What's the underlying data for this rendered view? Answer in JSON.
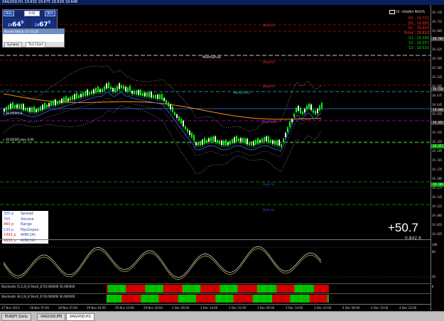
{
  "window": {
    "title": "XAGUSD,H1  19.632 19.675 19.629 19.648"
  },
  "trade_panel": {
    "sell_label": "SELL",
    "lot_value": "0.02",
    "buy_label": "BUY",
    "bid": {
      "prefix": "19",
      "big": "64",
      "sup": "5"
    },
    "ask": {
      "prefix": "19",
      "big": "67",
      "sup": "5"
    }
  },
  "market_watch": {
    "title": "Market Watch: 07:55:20",
    "tabs": [
      "Symbols",
      "Tick Chart"
    ]
  },
  "logo_text": "FX - HOURLY PIVOTS",
  "levels": {
    "daily_r3": "Daily R3",
    "daily_r2": "Daily R2",
    "daily_r1": "Daily R1",
    "monthly_pivot": "MonthlyPivot",
    "weekly_pivot": "WeeklyPivot",
    "daily_pivot": "Daily Pivot",
    "level_a": "» 19.25[00] 8",
    "level_b": "» 19.02[00]_box_0.00",
    "daily_s1": "Daily S1",
    "daily_s2": "Daily S2"
  },
  "pivots": [
    {
      "label": "R3 : 19.721",
      "color": "#ff2a2a"
    },
    {
      "label": "R2 : 19.683",
      "color": "#ff2a2a"
    },
    {
      "label": "R1 : 19.650",
      "color": "#ff2a2a"
    },
    {
      "label": "Pivot : 19.620",
      "color": "#ff3333"
    },
    {
      "label": "S1 : 19.595",
      "color": "#00e000"
    },
    {
      "label": "S2 : 19.557",
      "color": "#00e000"
    },
    {
      "label": "S3 : 19.520",
      "color": "#00e000"
    }
  ],
  "y_axis": {
    "ticks": [
      "19.745",
      "19.715",
      "19.685",
      "19.655",
      "19.625",
      "19.595",
      "19.565",
      "19.535",
      "19.505",
      "19.475",
      "19.445",
      "19.415",
      "19.385",
      "19.355",
      "19.325",
      "19.295",
      "19.265",
      "19.235",
      "19.205",
      "19.175",
      "19.145",
      "19.115",
      "19.085",
      "19.055",
      "19.025"
    ],
    "tags": [
      {
        "text": "19.745",
        "bg": "#4a4a4a"
      },
      {
        "text": "19.648",
        "bg": "#3a3a3a"
      },
      {
        "text": "19.510",
        "bg": "#3a3a3a"
      },
      {
        "text": "19.452",
        "bg": "#3a3a3a"
      },
      {
        "text": "19.357",
        "bg": "#00a000"
      },
      {
        "text": "19.246",
        "bg": "#00a000"
      }
    ],
    "sub_ticks": [
      "100",
      "80",
      "20",
      "0"
    ]
  },
  "info_box": [
    {
      "value": "300 p",
      "label": "Spread",
      "color": "#2a5bd7"
    },
    {
      "value": "700",
      "label": "Volume",
      "color": "#2a5bd7"
    },
    {
      "value": "480 p",
      "label": "Range",
      "color": "#cc2222"
    },
    {
      "value": "130 p",
      "label": "Pips2open",
      "color": "#2a5bd7"
    },
    {
      "value": "1493 p",
      "label": "AHR(14)",
      "color": "#cc2222"
    },
    {
      "value": "4918 p",
      "label": "ADR(14)",
      "color": "#cc2222"
    }
  ],
  "big_value": "+50.7",
  "big_sub": "0.842.6",
  "stoch": {
    "label": "Stoch(14,3,3) 78.6145 72.7177",
    "bar1_label": "Stochastic (5,3,3)_K Stoch_D 50.000000 30.000000",
    "bar2_label": "Stochastic (8,3,3)_K Stoch_D 50.000000 30.000000"
  },
  "x_axis": [
    "27 Nov 2013",
    "28 Nov 07:00",
    "28 Nov 15:00",
    "29 Nov 02:00",
    "29 Nov 10:00",
    "29 Nov 18:00",
    "2 Dec 06:00",
    "2 Dec 14:00",
    "2 Dec 22:00",
    "3 Dec 06:00",
    "3 Dec 14:00",
    "3 Dec 22:00",
    "4 Dec 06:00",
    "4 Dec 14:00",
    "4 Dec 22:00"
  ],
  "tabs": [
    {
      "label": "EURJPY,Daily",
      "active": false
    },
    {
      "label": "XAGUSD,M5",
      "active": false
    },
    {
      "label": "XAGUSD,H1",
      "active": true
    }
  ],
  "colors": {
    "bull_candle": "#00ff00",
    "bear_candle": "#ffffff",
    "ma_orange": "#ff8c1a",
    "ma_blue": "#3b6cff",
    "stoch_k": "#e8e8e8",
    "stoch_d": "#c7c34a",
    "bar_red": "#e00000",
    "bar_green": "#00d000"
  }
}
